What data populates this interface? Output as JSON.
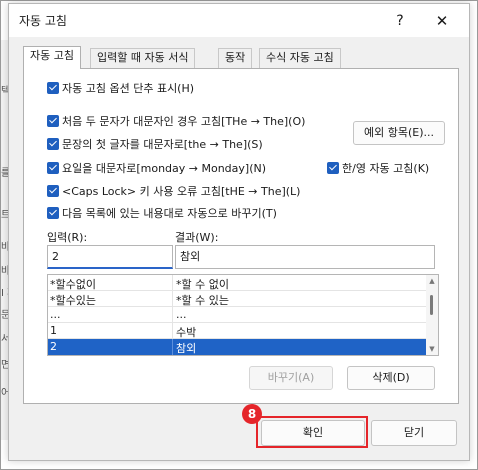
{
  "dialog": {
    "title": "자동 고침",
    "help": "?",
    "close": "✕"
  },
  "tabs": [
    {
      "label": "자동 고침",
      "active": true
    },
    {
      "label": "입력할 때 자동 서식",
      "active": false
    },
    {
      "label": "동작",
      "active": false
    },
    {
      "label": "수식 자동 고침",
      "active": false
    }
  ],
  "options": {
    "show_buttons": "자동 고침 옵션 단추 표시(H)",
    "two_initials": "처음 두 문자가 대문자인 경우 고침[THe → The](O)",
    "first_letter": "문장의 첫 글자를 대문자로[the → The](S)",
    "day_names": "요일을 대문자로[monday → Monday](N)",
    "han_eng": "한/영 자동 고침(K)",
    "caps_lock": "<Caps Lock> 키 사용 오류 고침[tHE → The](L)",
    "replace_text": "다음 목록에 있는 내용대로 자동으로 바꾸기(T)"
  },
  "exceptions_button": "예외 항목(E)...",
  "input_label": "입력(R):",
  "result_label": "결과(W):",
  "input_value": "2",
  "result_value": "참외",
  "list_rows": [
    {
      "input": "*할수없이",
      "result": "*할 수 없이",
      "selected": false
    },
    {
      "input": "*할수있는",
      "result": "*할 수 있는",
      "selected": false
    },
    {
      "input": "...",
      "result": "...",
      "selected": false
    },
    {
      "input": "1",
      "result": "수박",
      "selected": false
    },
    {
      "input": "2",
      "result": "참외",
      "selected": true
    }
  ],
  "replace_button": "바꾸기(A)",
  "delete_button": "삭제(D)",
  "ok_button": "확인",
  "close_button": "닫기",
  "step_badge": "8",
  "background_fragments": [
    "텍스",
    "를",
    "트로",
    "바어",
    "바어",
    "I 파",
    "문기",
    "서는",
    "면(",
    "어("
  ],
  "colors": {
    "accent": "#1f63c6",
    "badge": "#e5252a"
  }
}
